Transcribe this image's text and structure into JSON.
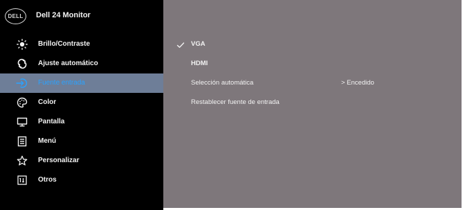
{
  "osd": {
    "brand": "DELL",
    "title": "Dell 24 Monitor"
  },
  "menu": [
    {
      "label": "Brillo/Contraste",
      "icon": "brightness-icon"
    },
    {
      "label": "Ajuste automático",
      "icon": "auto-adjust-icon"
    },
    {
      "label": "Fuente entrada",
      "icon": "input-source-icon",
      "selected": true
    },
    {
      "label": "Color",
      "icon": "color-palette-icon"
    },
    {
      "label": "Pantalla",
      "icon": "display-icon"
    },
    {
      "label": "Menú",
      "icon": "menu-icon"
    },
    {
      "label": "Personalizar",
      "icon": "star-icon"
    },
    {
      "label": "Otros",
      "icon": "others-icon"
    }
  ],
  "options": {
    "vga": "VGA",
    "hdmi": "HDMI",
    "auto_select": "Selección automática",
    "auto_select_value": "> Encedido",
    "reset_input": "Restablecer fuente de entrada"
  },
  "colors": {
    "sidebar_bg": "#000000",
    "panel_bg": "#7e777b",
    "selected_bg": "#6e7e98",
    "selected_text": "#2aa2ff",
    "text": "#f2f2f2"
  }
}
